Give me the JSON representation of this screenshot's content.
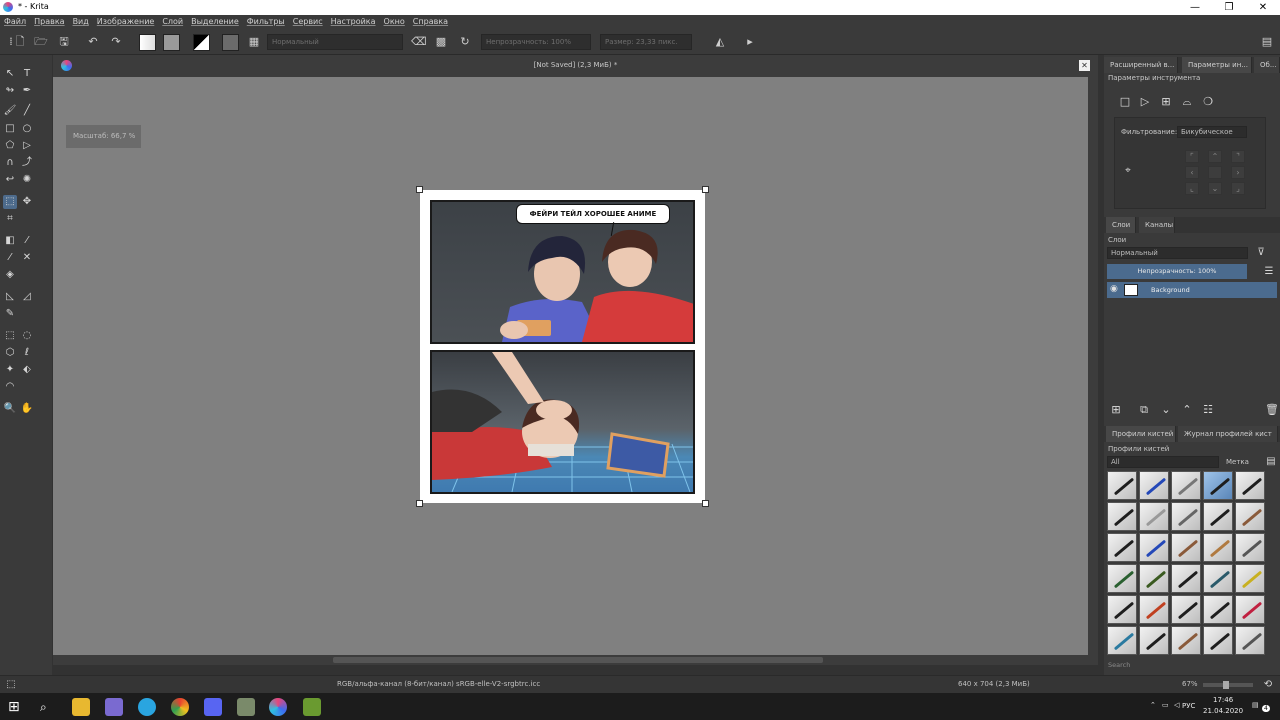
{
  "window": {
    "title": "* - Krita",
    "minimize": "—",
    "maximize": "❐",
    "close": "✕"
  },
  "menu": [
    "Файл",
    "Правка",
    "Вид",
    "Изображение",
    "Слой",
    "Выделение",
    "Фильтры",
    "Сервис",
    "Настройка",
    "Окно",
    "Справка"
  ],
  "toolbar": {
    "blend_mode": "Нормальный",
    "opacity": "Непрозрачность: 100%",
    "size": "Размер: 23,33 пикс."
  },
  "document": {
    "title": "[Not Saved]  (2,3 МиБ) *",
    "zoom_osd": "Масштаб: 66,7 %",
    "speech_text": "ФЕЙРИ ТЕЙЛ ХОРОШЕЕ АНИМЕ"
  },
  "dock": {
    "tabs": [
      "Расширенный в...",
      "Параметры ин...",
      "Об..."
    ],
    "tool_options_title": "Параметры инструмента",
    "filter_label": "Фильтрование:",
    "filter_value": "Бикубическое",
    "layer_tabs": [
      "Слои",
      "Каналы"
    ],
    "layers_title": "Слои",
    "layer_blend": "Нормальный",
    "layer_opacity": "Непрозрачность: 100%",
    "layer_name": "Background",
    "brush_tabs": [
      "Профили кистей",
      "Журнал профилей кист"
    ],
    "brush_title": "Профили кистей",
    "brush_filter": "All",
    "brush_tag": "Метка",
    "search_placeholder": "Search"
  },
  "status": {
    "color_space": "RGB/альфа-канал (8-бит/канал)  sRGB-elle-V2-srgbtrc.icc",
    "dimensions": "640 x 704 (2,3 МиБ)",
    "zoom": "67%"
  },
  "taskbar": {
    "lang": "РУС",
    "time": "17:46",
    "date": "21.04.2020",
    "notif_count": "4"
  },
  "colors": {
    "accent": "#4b6b8e",
    "canvas_bg": "#808080",
    "chrome": "#3a3a3a"
  }
}
